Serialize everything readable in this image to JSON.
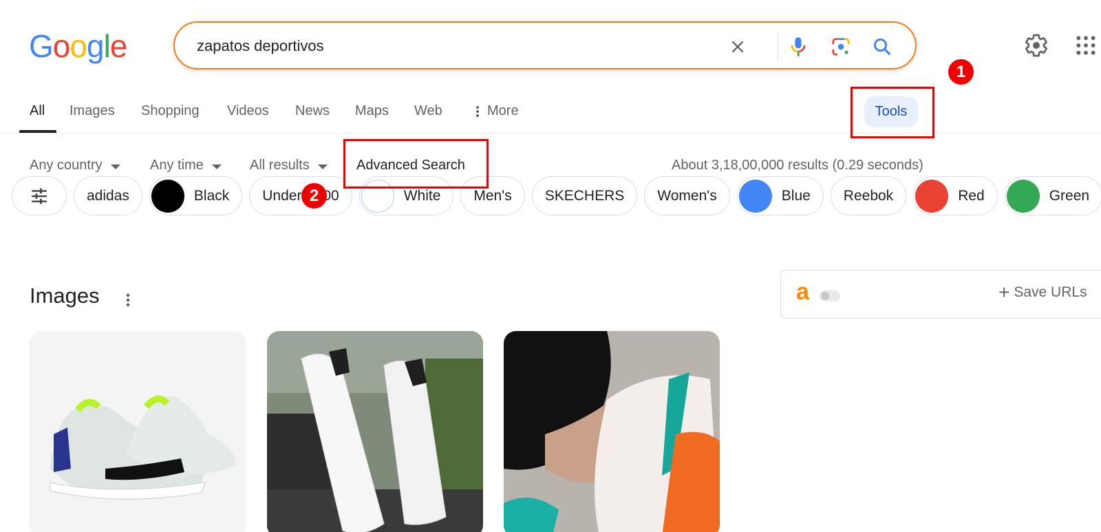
{
  "logo": {
    "letters": [
      {
        "char": "G",
        "color": "#4285f4"
      },
      {
        "char": "o",
        "color": "#ea4335"
      },
      {
        "char": "o",
        "color": "#fbbc05"
      },
      {
        "char": "g",
        "color": "#4285f4"
      },
      {
        "char": "l",
        "color": "#34a853"
      },
      {
        "char": "e",
        "color": "#ea4335"
      }
    ]
  },
  "search": {
    "query": "zapatos deportivos",
    "icons": [
      "close-icon",
      "microphone-icon",
      "camera-lens-icon",
      "search-icon"
    ]
  },
  "header_icons": [
    "gear-icon",
    "apps-grid-icon"
  ],
  "tabs": [
    {
      "label": "All",
      "active": true
    },
    {
      "label": "Images"
    },
    {
      "label": "Shopping"
    },
    {
      "label": "Videos"
    },
    {
      "label": "News"
    },
    {
      "label": "Maps"
    },
    {
      "label": "Web"
    },
    {
      "label": "More",
      "icon": "more-vert-icon"
    }
  ],
  "tools_label": "Tools",
  "annotations": [
    {
      "number": "1",
      "target": "Tools"
    },
    {
      "number": "2",
      "target": "Advanced Search"
    }
  ],
  "filters": [
    {
      "label": "Any country"
    },
    {
      "label": "Any time"
    },
    {
      "label": "All results"
    }
  ],
  "advanced_search_label": "Advanced Search",
  "result_stats": "About 3,18,00,000 results (0.29 seconds)",
  "chips": [
    {
      "label": "",
      "icon": "tune-icon"
    },
    {
      "label": "adidas"
    },
    {
      "label": "Black",
      "swatch": "#000000"
    },
    {
      "label": "Under ₹500"
    },
    {
      "label": "White",
      "swatch": "#ffffff"
    },
    {
      "label": "Men's"
    },
    {
      "label": "SKECHERS"
    },
    {
      "label": "Women's"
    },
    {
      "label": "Blue",
      "swatch": "#4285f4"
    },
    {
      "label": "Reebok"
    },
    {
      "label": "Red",
      "swatch": "#ea4335"
    },
    {
      "label": "Green",
      "swatch": "#34a853"
    }
  ],
  "images_section": {
    "heading": "Images",
    "thumbnails": [
      {
        "description": "light grey running shoes with neon green and navy accents"
      },
      {
        "description": "white high-top sneakers outdoors"
      },
      {
        "description": "white running shoe with teal and orange sole"
      }
    ]
  },
  "extension": {
    "logo": "a",
    "toggle_on": false,
    "save_label": "Save URLs"
  }
}
